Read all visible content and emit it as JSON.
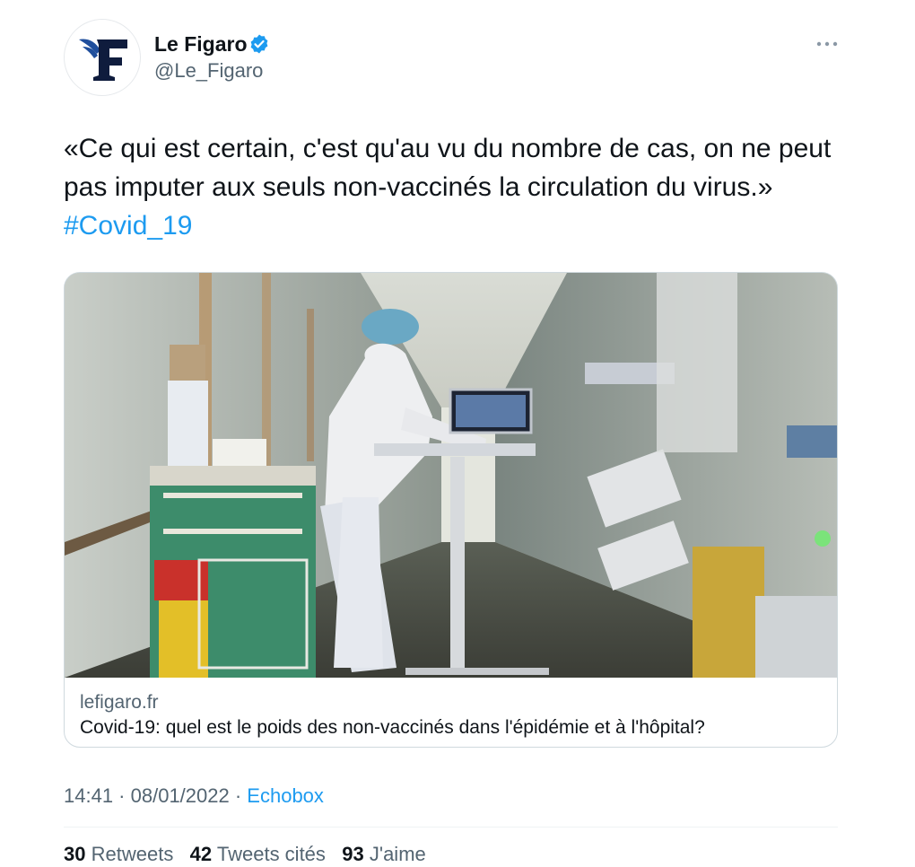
{
  "author": {
    "name": "Le Figaro",
    "handle": "@Le_Figaro",
    "verified": true,
    "avatar_letter": "F"
  },
  "menu_icon": "more-horizontal-icon",
  "tweet": {
    "text": "«Ce qui est certain, c'est qu'au vu du nombre de cas, on ne peut pas imputer aux seuls non-vaccinés la circulation du virus.»",
    "hashtag": "#Covid_19"
  },
  "card": {
    "image": "hospital-corridor-photo",
    "domain": "lefigaro.fr",
    "title": "Covid-19: quel est le poids des non-vaccinés dans l'épidémie et à l'hôpital?"
  },
  "meta": {
    "time": "14:41",
    "separator": " · ",
    "date": "08/01/2022",
    "source": "Echobox"
  },
  "stats": {
    "retweets_count": "30",
    "retweets_label": "Retweets",
    "quotes_count": "42",
    "quotes_label": "Tweets cités",
    "likes_count": "93",
    "likes_label": "J'aime"
  },
  "colors": {
    "link": "#1d9bf0",
    "secondary_text": "#536471",
    "verified_badge": "#1d9bf0",
    "avatar_bird": "#1f4e9c",
    "avatar_letter": "#0f1c3d"
  }
}
